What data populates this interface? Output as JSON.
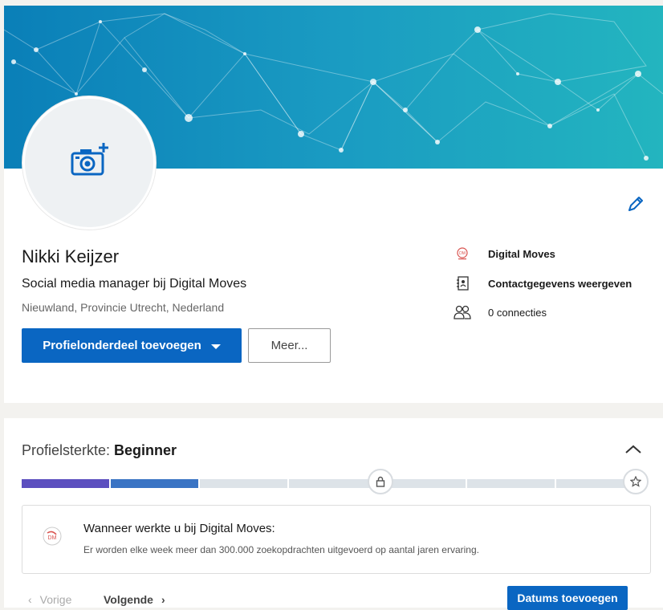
{
  "profile": {
    "name": "Nikki Keijzer",
    "headline": "Social media manager bij Digital Moves",
    "location": "Nieuwland, Provincie Utrecht, Nederland",
    "add_section_label": "Profielonderdeel toevoegen",
    "more_label": "Meer..."
  },
  "side": {
    "company": "Digital Moves",
    "contact": "Contactgegevens weergeven",
    "connections": "0 connecties"
  },
  "strength": {
    "label": "Profielsterkte: ",
    "level": "Beginner",
    "completed_segments": 2,
    "total_segments": 7,
    "tip_title": "Wanneer werkte u bij Digital Moves:",
    "tip_text": "Er worden elke week meer dan 300.000 zoekopdrachten uitgevoerd op aantal jaren ervaring.",
    "prev_label": "Vorige",
    "next_label": "Volgende",
    "action_label": "Datums toevoegen"
  },
  "colors": {
    "accent": "#0a66c2",
    "progress_1": "#5c4fbf",
    "progress_2": "#3a74c4",
    "track": "#dde3e8"
  },
  "icons": {
    "avatar": "camera-plus-icon",
    "edit": "pencil-icon",
    "company": "company-logo-icon",
    "contact": "address-book-icon",
    "connections": "people-icon",
    "collapse": "chevron-up-icon",
    "milestone": "lock-icon",
    "goal": "star-icon"
  }
}
